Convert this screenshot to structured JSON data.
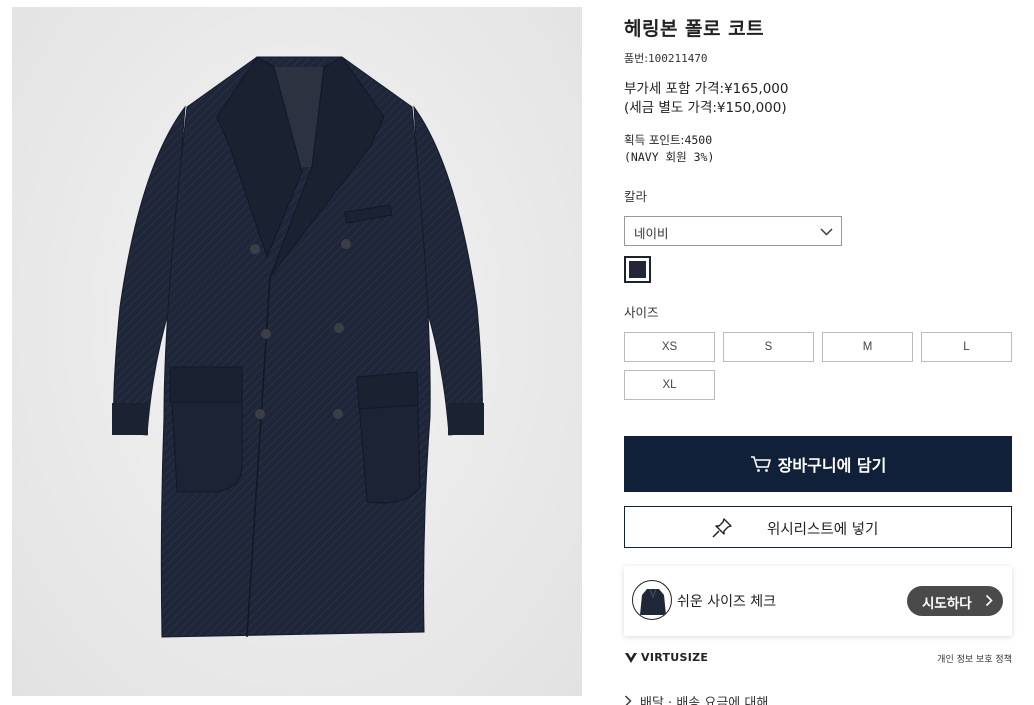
{
  "product": {
    "title": "헤링본 폴로 코트",
    "sku_label": "품번:",
    "sku": "100211470",
    "price_incl": "부가세 포함 가격:¥165,000",
    "price_excl": "(세금 별도 가격:¥150,000)",
    "points_label": "획득 포인트:",
    "points_value": "4500",
    "points_note": "(NAVY 회원 3%)"
  },
  "color": {
    "label": "칼라",
    "selected": "네이비",
    "swatch_hex": "#1f2738"
  },
  "size": {
    "label": "사이즈",
    "options": [
      "XS",
      "S",
      "M",
      "L",
      "XL"
    ]
  },
  "actions": {
    "add_to_cart": "장바구니에 담기",
    "add_to_wishlist": "위시리스트에 넣기"
  },
  "virtusize": {
    "prompt": "쉬운 사이즈 체크",
    "try_button": "시도하다",
    "logo": "VIRTUSIZE",
    "privacy_link": "개인 정보 보호 정책"
  },
  "delivery": {
    "label": "배달 · 배송 요금에 대해"
  },
  "colors": {
    "primary_navy": "#0f2038",
    "coat": "#1f2738",
    "pill": "#4a4a4a"
  }
}
